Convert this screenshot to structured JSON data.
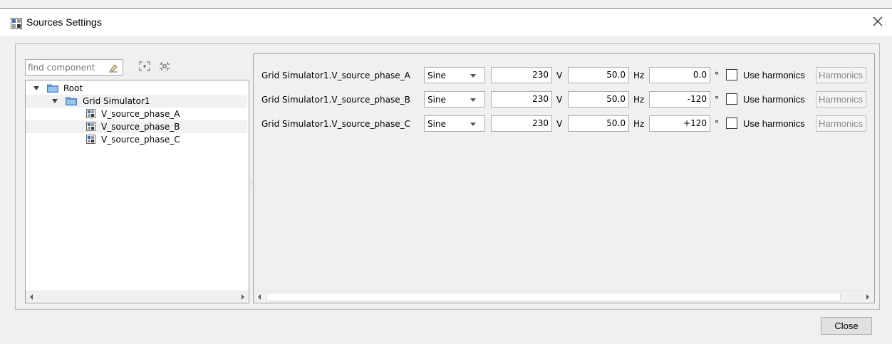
{
  "window": {
    "title": "Sources Settings",
    "close_icon": "close-icon"
  },
  "search": {
    "placeholder": "find component"
  },
  "toolbar": {
    "icons": [
      "clear-search-icon",
      "expand-all-icon",
      "collapse-all-icon"
    ]
  },
  "tree": {
    "root": "Root",
    "group": "Grid Simulator1",
    "children": [
      "V_source_phase_A",
      "V_source_phase_B",
      "V_source_phase_C"
    ]
  },
  "sources": [
    {
      "name": "Grid Simulator1.V_source_phase_A",
      "type": "Sine",
      "voltage": "230",
      "voltage_unit": "V",
      "frequency": "50.0",
      "frequency_unit": "Hz",
      "phase": "0.0",
      "phase_unit": "°",
      "use_harmonics_label": "Use harmonics",
      "harmonics_button": "Harmonics"
    },
    {
      "name": "Grid Simulator1.V_source_phase_B",
      "type": "Sine",
      "voltage": "230",
      "voltage_unit": "V",
      "frequency": "50.0",
      "frequency_unit": "Hz",
      "phase": "-120",
      "phase_unit": "°",
      "use_harmonics_label": "Use harmonics",
      "harmonics_button": "Harmonics"
    },
    {
      "name": "Grid Simulator1.V_source_phase_C",
      "type": "Sine",
      "voltage": "230",
      "voltage_unit": "V",
      "frequency": "50.0",
      "frequency_unit": "Hz",
      "phase": "+120",
      "phase_unit": "°",
      "use_harmonics_label": "Use harmonics",
      "harmonics_button": "Harmonics"
    }
  ],
  "footer": {
    "close_label": "Close"
  },
  "colors": {
    "background": "#f0f0f0",
    "panel": "#ffffff",
    "folder": "#5b9bd5",
    "alt_row": "#f1f1f1"
  }
}
